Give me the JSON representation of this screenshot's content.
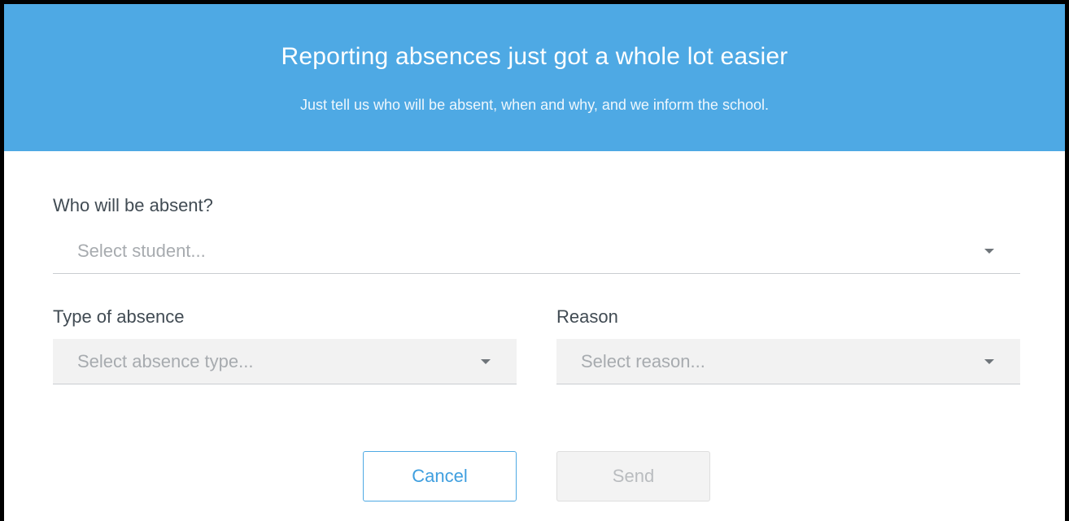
{
  "header": {
    "title": "Reporting absences just got a whole lot easier",
    "subtitle": "Just tell us who will be absent, when and why, and we inform the school.",
    "background_color": "#4ea9e4"
  },
  "form": {
    "student": {
      "label": "Who will be absent?",
      "placeholder": "Select student...",
      "icon": "chevron-down-icon"
    },
    "absence_type": {
      "label": "Type of absence",
      "placeholder": "Select absence type...",
      "icon": "chevron-down-icon"
    },
    "reason": {
      "label": "Reason",
      "placeholder": "Select reason...",
      "icon": "chevron-down-icon"
    }
  },
  "actions": {
    "cancel_label": "Cancel",
    "send_label": "Send",
    "accent_color": "#4ea9e4"
  }
}
